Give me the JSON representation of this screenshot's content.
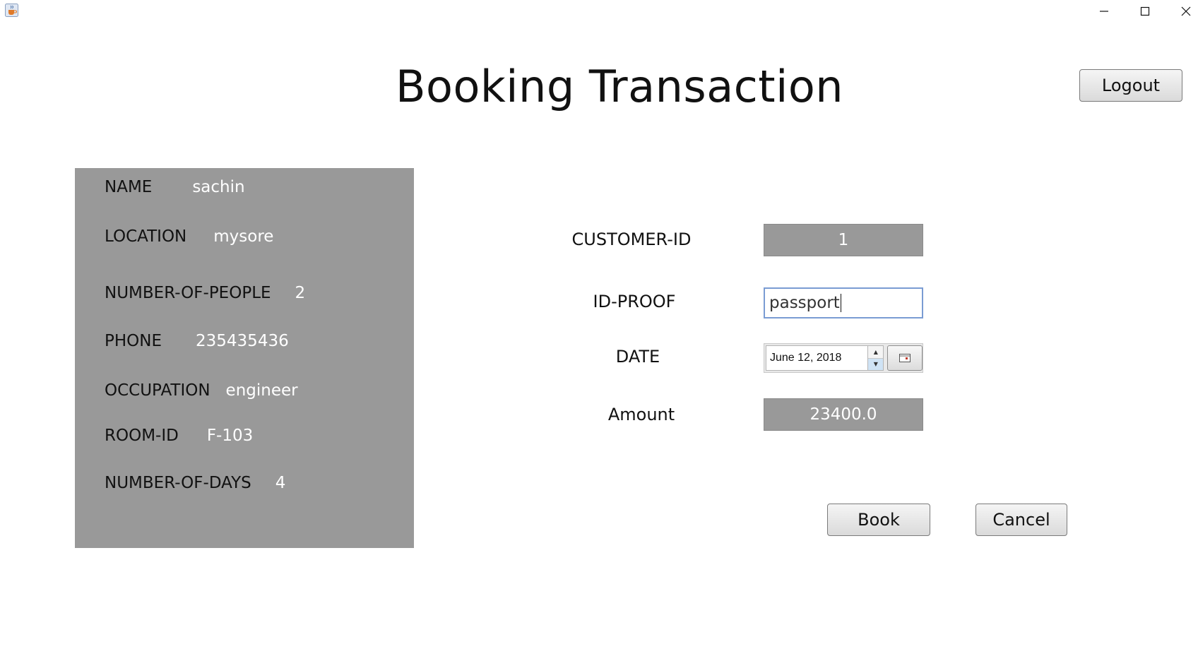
{
  "window": {
    "app_icon": "java-coffee-icon",
    "controls": [
      "minimize-icon",
      "maximize-icon",
      "close-icon"
    ]
  },
  "header": {
    "title": "Booking Transaction",
    "logout_label": "Logout"
  },
  "customer_info": {
    "name": {
      "label": "NAME",
      "value": "sachin"
    },
    "location": {
      "label": "LOCATION",
      "value": "mysore"
    },
    "people": {
      "label": "NUMBER-OF-PEOPLE",
      "value": "2"
    },
    "phone": {
      "label": "PHONE",
      "value": "235435436"
    },
    "occupation": {
      "label": "OCCUPATION",
      "value": "engineer"
    },
    "room": {
      "label": "ROOM-ID",
      "value": "F-103"
    },
    "days": {
      "label": "NUMBER-OF-DAYS",
      "value": "4"
    }
  },
  "form": {
    "customer_id": {
      "label": "CUSTOMER-ID",
      "value": "1"
    },
    "id_proof": {
      "label": "ID-PROOF",
      "value": "passport"
    },
    "date": {
      "label": "DATE",
      "value": "June 12, 2018",
      "picker_icon": "calendar-icon"
    },
    "amount": {
      "label": "Amount",
      "value": "23400.0"
    }
  },
  "actions": {
    "book_label": "Book",
    "cancel_label": "Cancel"
  },
  "colors": {
    "panel_bg": "#999999",
    "panel_value_text": "#ffffff",
    "input_focus_border": "#7a9cd3"
  }
}
